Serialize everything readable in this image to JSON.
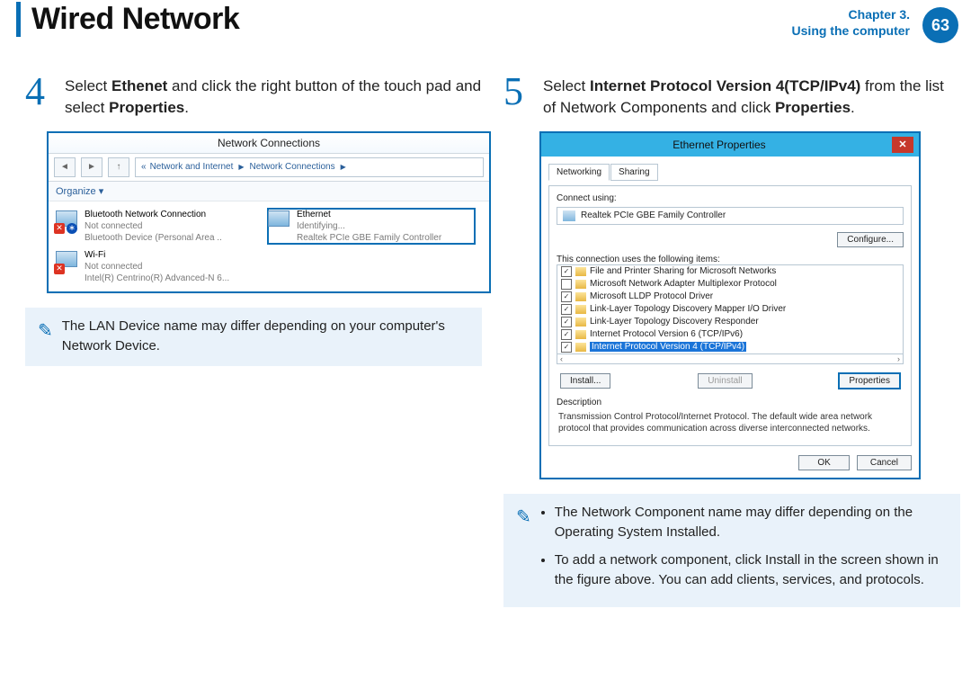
{
  "header": {
    "title": "Wired Network",
    "chapter_line1": "Chapter 3.",
    "chapter_line2": "Using the computer",
    "page_number": "63"
  },
  "step4": {
    "num": "4",
    "text_a": "Select ",
    "bold_a": "Ethenet",
    "text_b": " and click the right button of the touch pad and select ",
    "bold_b": "Properties",
    "text_c": "."
  },
  "step5": {
    "num": "5",
    "text_a": "Select ",
    "bold_a": "Internet Protocol Version 4(TCP/IPv4)",
    "text_b": " from the list of Network Components and click ",
    "bold_b": "Properties",
    "text_c": "."
  },
  "nc": {
    "title": "Network Connections",
    "breadcrumb_a": "Network and Internet",
    "breadcrumb_b": "Network Connections",
    "organize": "Organize ▾",
    "items": [
      {
        "name": "Bluetooth Network Connection",
        "sub1": "Not connected",
        "sub2": "Bluetooth Device (Personal Area ..",
        "bt": true
      },
      {
        "name": "Ethernet",
        "sub1": "Identifying...",
        "sub2": "Realtek PCIe GBE Family Controller",
        "sel": true
      },
      {
        "name": "Wi-Fi",
        "sub1": "Not connected",
        "sub2": "Intel(R) Centrino(R) Advanced-N 6..."
      }
    ]
  },
  "note1": "The LAN Device name may differ depending on your computer's Network Device.",
  "ep": {
    "title": "Ethernet Properties",
    "tab1": "Networking",
    "tab2": "Sharing",
    "connect_label": "Connect using:",
    "adapter": "Realtek PCIe GBE Family Controller",
    "configure": "Configure...",
    "items_label": "This connection uses the following items:",
    "items": [
      {
        "c": true,
        "t": "File and Printer Sharing for Microsoft Networks"
      },
      {
        "c": false,
        "t": "Microsoft Network Adapter Multiplexor Protocol"
      },
      {
        "c": true,
        "t": "Microsoft LLDP Protocol Driver"
      },
      {
        "c": true,
        "t": "Link-Layer Topology Discovery Mapper I/O Driver"
      },
      {
        "c": true,
        "t": "Link-Layer Topology Discovery Responder"
      },
      {
        "c": true,
        "t": "Internet Protocol Version 6 (TCP/IPv6)"
      },
      {
        "c": true,
        "t": "Internet Protocol Version 4 (TCP/IPv4)",
        "sel": true
      }
    ],
    "install": "Install...",
    "uninstall": "Uninstall",
    "properties": "Properties",
    "desc_label": "Description",
    "desc": "Transmission Control Protocol/Internet Protocol. The default wide area network protocol that provides communication across diverse interconnected networks.",
    "ok": "OK",
    "cancel": "Cancel"
  },
  "note2": {
    "a": "The Network Component name may differ depending on the Operating System Installed.",
    "b": "To add a network component, click Install in the screen shown in the figure above. You can add clients, services, and protocols."
  }
}
